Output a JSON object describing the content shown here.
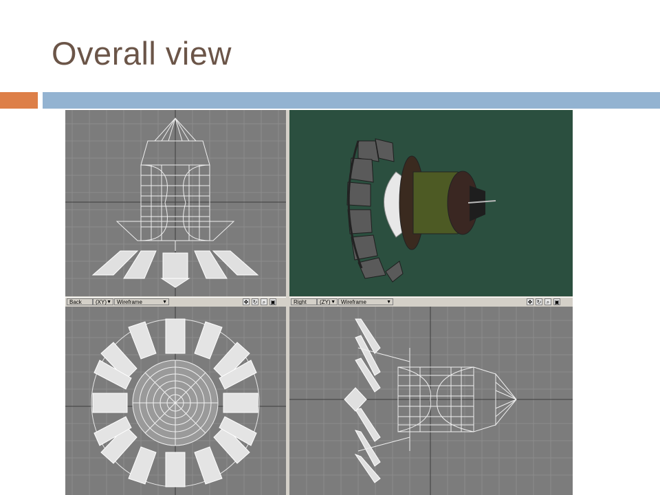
{
  "slide": {
    "title": "Overall view"
  },
  "colors": {
    "title_text": "#6b5548",
    "accent_orange": "#dd7f48",
    "accent_blue": "#93b3d1",
    "viewport_gray": "#7c7c7c",
    "viewport_green": "#2b4f3f"
  },
  "viewports": {
    "back": {
      "view_label": "Back",
      "axis_label": "(XY)",
      "mode_label": "Wireframe"
    },
    "right": {
      "view_label": "Right",
      "axis_label": "(ZY)",
      "mode_label": "Wireframe"
    }
  },
  "toolbar_icons": [
    "move-icon",
    "rotate-icon",
    "zoom-icon",
    "maximize-icon"
  ]
}
